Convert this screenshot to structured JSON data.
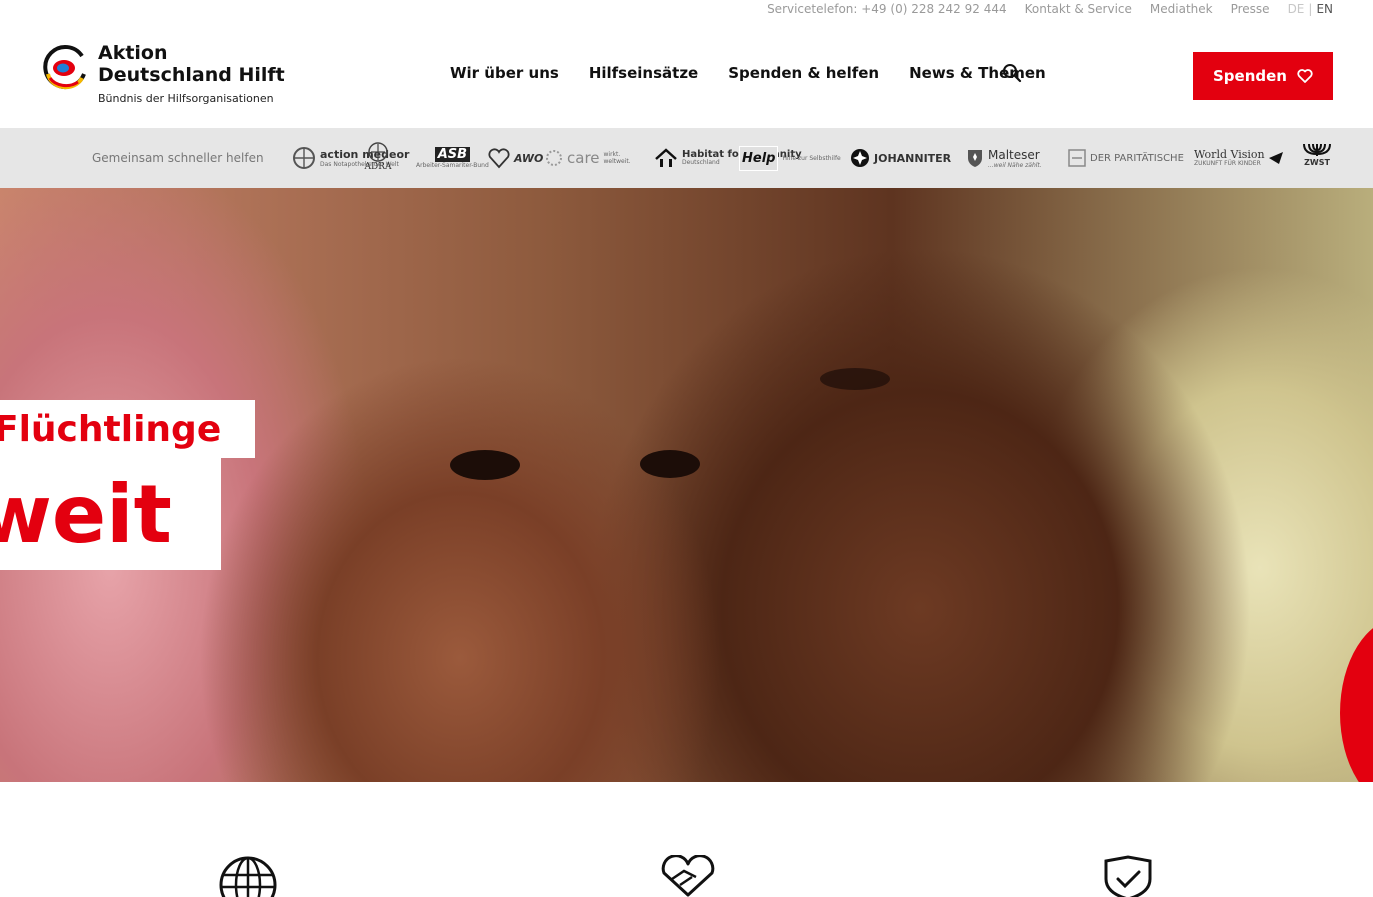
{
  "topbar": {
    "phone": "Servicetelefon: +49 (0) 228 242 92 444",
    "contact": "Kontakt & Service",
    "media": "Mediathek",
    "press": "Presse",
    "lang_de": "DE",
    "lang_sep": "|",
    "lang_en": "EN"
  },
  "logo": {
    "line1": "Aktion",
    "line2": "Deutschland Hilft",
    "tagline": "Bündnis der Hilfsorganisationen"
  },
  "nav": {
    "items": [
      "Wir über uns",
      "Hilfseinsätze",
      "Spenden & helfen",
      "News & Themen"
    ]
  },
  "donate": {
    "label": "Spenden"
  },
  "partners": {
    "label": "Gemeinsam schneller helfen",
    "items": [
      {
        "name": "action medeor",
        "sub": "Das Notapotheke der Welt"
      },
      {
        "name": "ADRA",
        "sub": ""
      },
      {
        "name": "ASB",
        "sub": "Arbeiter-Samariter-Bund"
      },
      {
        "name": "AWO",
        "sub": ""
      },
      {
        "name": "care",
        "sub": "wirkt. weltweit."
      },
      {
        "name": "Habitat for Humanity",
        "sub": "Deutschland"
      },
      {
        "name": "Help",
        "sub": "Hilfe zur Selbsthilfe"
      },
      {
        "name": "JOHANNITER",
        "sub": ""
      },
      {
        "name": "Malteser",
        "sub": "...weil Nähe zählt."
      },
      {
        "name": "DER PARITÄTISCHE",
        "sub": ""
      },
      {
        "name": "World Vision",
        "sub": "ZUKUNFT FÜR KINDER"
      },
      {
        "name": "ZWST",
        "sub": ""
      }
    ]
  },
  "hero": {
    "line1": "Flüchtlinge",
    "line2": "weit"
  },
  "colors": {
    "accent": "#e3000f",
    "partner_bar": "#e6e6e6"
  },
  "icons": [
    "globe-icon",
    "heart-handshake-icon",
    "shield-check-icon"
  ]
}
